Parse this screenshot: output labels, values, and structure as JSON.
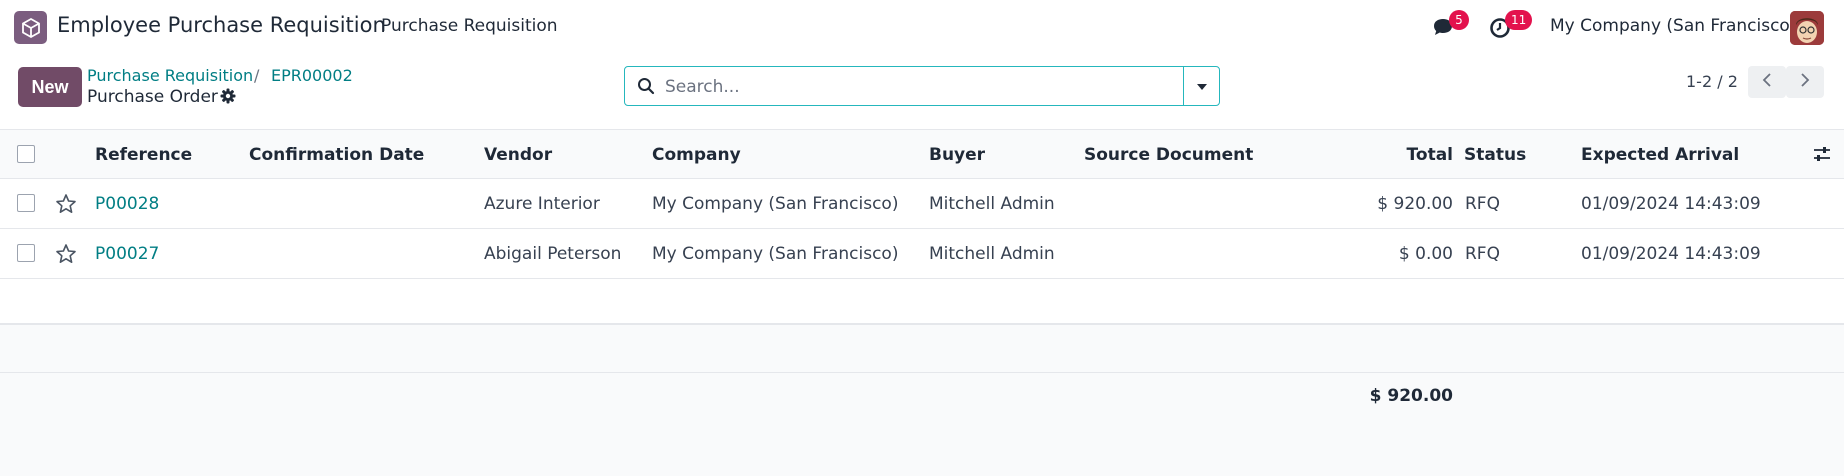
{
  "navbar": {
    "app_title": "Employee Purchase Requisition",
    "menu_item": "Purchase Requisition",
    "messages_badge": "5",
    "activities_badge": "11",
    "company": "My Company (San Francisco)",
    "brand_color": "#714b67"
  },
  "control_panel": {
    "new_label": "New",
    "breadcrumb": [
      "Purchase Requisition",
      "EPR00002"
    ],
    "breadcrumb_separator": "/",
    "sub_title": "Purchase Order",
    "search_placeholder": "Search...",
    "pager": "1-2 / 2"
  },
  "table": {
    "columns": [
      "Reference",
      "Confirmation Date",
      "Vendor",
      "Company",
      "Buyer",
      "Source Document",
      "Total",
      "Status",
      "Expected Arrival"
    ],
    "rows": [
      {
        "reference": "P00028",
        "confirmation_date": "",
        "vendor": "Azure Interior",
        "company": "My Company (San Francisco)",
        "buyer": "Mitchell Admin",
        "source_document": "",
        "total": "$ 920.00",
        "status": "RFQ",
        "expected_arrival": "01/09/2024 14:43:09"
      },
      {
        "reference": "P00027",
        "confirmation_date": "",
        "vendor": "Abigail Peterson",
        "company": "My Company (San Francisco)",
        "buyer": "Mitchell Admin",
        "source_document": "",
        "total": "$ 0.00",
        "status": "RFQ",
        "expected_arrival": "01/09/2024 14:43:09"
      }
    ],
    "grand_total": "$ 920.00"
  },
  "icons": [
    "app-cube-icon",
    "chat-icon",
    "clock-icon",
    "gear-icon",
    "search-icon",
    "caret-down-icon",
    "chevron-left-icon",
    "chevron-right-icon",
    "star-icon",
    "sliders-icon"
  ]
}
